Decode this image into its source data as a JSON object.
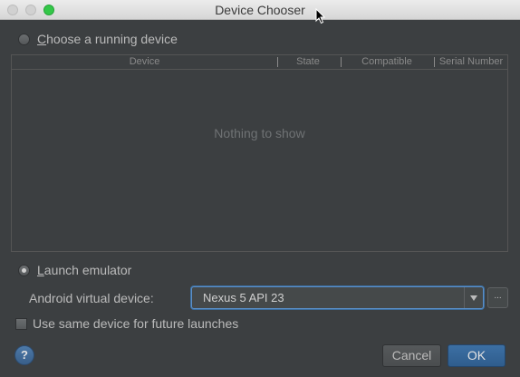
{
  "window": {
    "title": "Device Chooser"
  },
  "running": {
    "label_mnemonic": "C",
    "label_rest": "hoose a running device",
    "selected": false
  },
  "table": {
    "columns": [
      "Device",
      "State",
      "Compatible",
      "Serial Number"
    ],
    "empty_text": "Nothing to show"
  },
  "emulator": {
    "label_mnemonic": "L",
    "label_rest": "aunch emulator",
    "selected": true,
    "avd_label": "Android virtual device:",
    "avd_value": "Nexus 5 API 23",
    "browse_label": "..."
  },
  "same_device": {
    "label": "Use same device for future launches",
    "checked": false
  },
  "footer": {
    "help_label": "?",
    "cancel_label": "Cancel",
    "ok_label": "OK"
  },
  "colors": {
    "background": "#3c3f41",
    "accent": "#3c6fa3",
    "focus_border": "#5a8fc8"
  }
}
